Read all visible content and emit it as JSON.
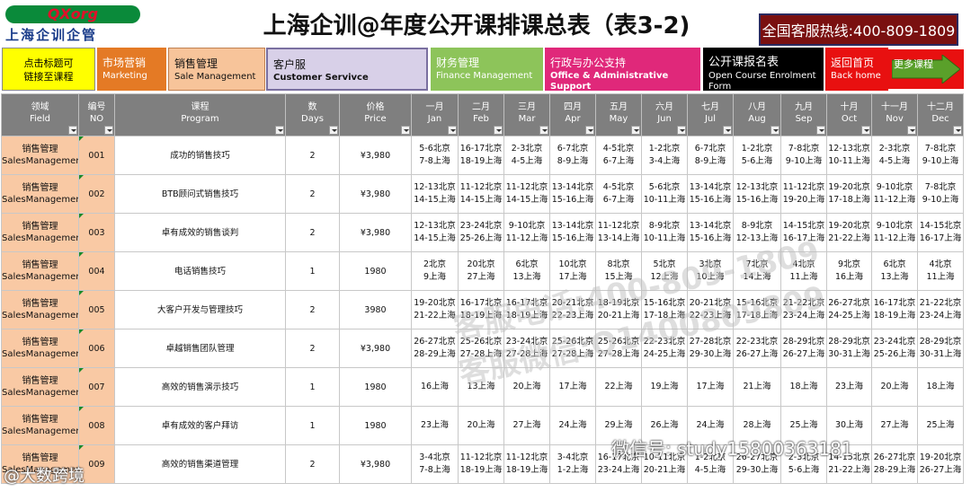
{
  "header": {
    "logo_brand": "QXorg",
    "logo_sub": "上海企训企管",
    "title": "上海企训@年度公开课排课总表（表3-2)",
    "hotline": "全国客服热线:400-809-1809"
  },
  "nav": {
    "click_line1": "点击标题可",
    "click_line2": "链接至课程",
    "marketing_cn": "市场营销",
    "marketing_en": "Marketing",
    "sales_cn": "销售管理",
    "sales_en": "Sale Management",
    "cs_cn": "客户服",
    "cs_en": "Customer Servivce",
    "finance_cn": "财务管理",
    "finance_en": "Finance Management",
    "admin_cn": "行政与办公支持",
    "admin_en": "Office & Administrative Support",
    "course_cn": "公开课报名表",
    "course_en": "Open Course Enrolment Form",
    "home_cn": "返回首页",
    "home_en": "Back home",
    "more": "更多课程"
  },
  "colors": {
    "header_gray": "#7f7f7f",
    "field_peach": "#f9c9a4",
    "hotline_red": "#7a1010"
  },
  "table": {
    "columns": [
      {
        "cn": "领域",
        "en": "Field"
      },
      {
        "cn": "编号",
        "en": "NO"
      },
      {
        "cn": "课程",
        "en": "Program"
      },
      {
        "cn": "数",
        "en": "Days"
      },
      {
        "cn": "价格",
        "en": "Price"
      },
      {
        "cn": "一月",
        "en": "Jan"
      },
      {
        "cn": "二月",
        "en": "Feb"
      },
      {
        "cn": "三月",
        "en": "Mar"
      },
      {
        "cn": "四月",
        "en": "Apr"
      },
      {
        "cn": "五月",
        "en": "May"
      },
      {
        "cn": "六月",
        "en": "Jun"
      },
      {
        "cn": "七月",
        "en": "Jul"
      },
      {
        "cn": "八月",
        "en": "Aug"
      },
      {
        "cn": "九月",
        "en": "Sep"
      },
      {
        "cn": "十月",
        "en": "Oct"
      },
      {
        "cn": "十一月",
        "en": "Nov"
      },
      {
        "cn": "十二月",
        "en": "Dec"
      }
    ],
    "rows": [
      {
        "field": "销售管理 SalesManagement",
        "no": "001",
        "program": "成功的销售技巧",
        "days": "2",
        "price": "¥3,980",
        "months": [
          "5-6北京 7-8上海",
          "16-17北京 18-19上海",
          "2-3北京 4-5上海",
          "6-7北京 8-9上海",
          "4-5北京 6-7上海",
          "1-2北京 3-4上海",
          "6-7北京 8-9上海",
          "1-2北京 5-6上海",
          "7-8北京 9-10上海",
          "12-13北京 10-11上海",
          "2-3北京 4-5上海",
          "7-8北京 9-10上海"
        ]
      },
      {
        "field": "销售管理 SalesManagement",
        "no": "002",
        "program": "BTB顾问式销售技巧",
        "days": "2",
        "price": "¥3,980",
        "months": [
          "12-13北京 14-15上海",
          "11-12北京 14-15上海",
          "11-12北京 14-15上海",
          "13-14北京 15-16上海",
          "4-5北京 6-7上海",
          "5-6北京 10-11上海",
          "13-14北京 15-16上海",
          "12-13北京 15-16上海",
          "11-12北京 19-20上海",
          "19-20北京 17-18上海",
          "9-10北京 11-12上海",
          "7-8北京 9-10上海"
        ]
      },
      {
        "field": "销售管理 SalesManagement",
        "no": "003",
        "program": "卓有成效的销售谈判",
        "days": "2",
        "price": "¥3,980",
        "months": [
          "12-13北京 14-15上海",
          "23-24北京 25-26上海",
          "9-10北京 11-12上海",
          "13-14北京 15-16上海",
          "11-12北京 13-14上海",
          "8-9北京 10-11上海",
          "13-14北京 15-16上海",
          "8-9北京 12-13上海",
          "14-15北京 16-17上海",
          "19-20北京 21-22上海",
          "9-10北京 11-12上海",
          "14-15北京 16-17上海"
        ]
      },
      {
        "field": "销售管理 SalesManagement",
        "no": "004",
        "program": "电话销售技巧",
        "days": "1",
        "price": "1980",
        "months": [
          "2北京 9上海",
          "20北京 27上海",
          "6北京 13上海",
          "10北京 17上海",
          "8北京 15上海",
          "5北京 12上海",
          "3北京 10上海",
          "7北京 14上海",
          "4北京 11上海",
          "9北京 16上海",
          "6北京 13上海",
          "4北京 11上海"
        ]
      },
      {
        "field": "销售管理 SalesManagement",
        "no": "005",
        "program": "大客户开发与管理技巧",
        "days": "2",
        "price": "3980",
        "months": [
          "19-20北京 21-22上海",
          "16-17北京 18-19上海",
          "16-17北京 18-19上海",
          "20-21北京 22-23上海",
          "18-19北京 20-21上海",
          "15-16北京 17-18上海",
          "20-21北京 22-23上海",
          "15-16北京 17-18上海",
          "21-22北京 23-24上海",
          "26-27北京 24-25上海",
          "16-17北京 18-19上海",
          "21-22北京 23-24上海"
        ]
      },
      {
        "field": "销售管理 SalesManagement",
        "no": "006",
        "program": "卓越销售团队管理",
        "days": "2",
        "price": "¥3,980",
        "months": [
          "26-27北京 28-29上海",
          "25-26北京 27-28上海",
          "23-24北京 27-28上海",
          "25-26北京 27-28上海",
          "25-26北京 27-28上海",
          "22-23北京 24-25上海",
          "27-28北京 29-30上海",
          "22-23北京 26-27上海",
          "28-29北京 26-27上海",
          "28-29北京 30-31上海",
          "23-24北京 25-26上海",
          "28-29北京 30-31上海"
        ]
      },
      {
        "field": "销售管理 SalesManagement",
        "no": "007",
        "program": "高效的销售演示技巧",
        "days": "1",
        "price": "1980",
        "months": [
          "16上海",
          "13上海",
          "20上海",
          "17上海",
          "22上海",
          "19上海",
          "17上海",
          "21上海",
          "18上海",
          "23上海",
          "20上海",
          "18上海"
        ]
      },
      {
        "field": "销售管理 SalesManagement",
        "no": "008",
        "program": "卓有成效的客户拜访",
        "days": "1",
        "price": "1980",
        "months": [
          "23上海",
          "20上海",
          "27上海",
          "24上海",
          "29上海",
          "26上海",
          "24上海",
          "28上海",
          "25上海",
          "30上海",
          "27上海",
          "25上海"
        ]
      },
      {
        "field": "销售管理 SalesManagement",
        "no": "009",
        "program": "高效的销售渠道管理",
        "days": "2",
        "price": "¥3,980",
        "months": [
          "3-4北京 7-8上海",
          "11-12北京 18-19上海",
          "11-12北京 18-19上海",
          "3-4北京 1-2上海",
          "16-17北京 23-24上海",
          "10-11北京 20-21上海",
          "1-2北京 4-5上海",
          "26-27北京 29-30上海",
          "2-3北京 5-6上海",
          "14-15北京 21-22上海",
          "26-27北京 28-29上海",
          "19-20北京 26-27上海"
        ]
      }
    ]
  },
  "watermarks": {
    "center_line1": "客服电话:400-809-1809",
    "center_line2": "客服微信:Q1400809809",
    "footer_right": "微信号: study15800363181",
    "footer_left": "@大数跨境"
  }
}
